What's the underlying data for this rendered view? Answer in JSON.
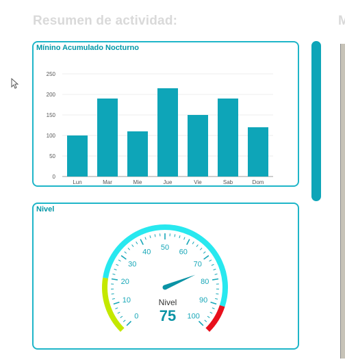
{
  "header": {
    "title": "Resumen de actividad:",
    "right_title_fragment": "M"
  },
  "bar_card": {
    "title": "Mínino Acumulado Nocturno"
  },
  "gauge_card": {
    "title": "Nivel"
  },
  "colors": {
    "accent": "#0ea5b8",
    "bar": "#0ea5b8",
    "title": "#0097a7",
    "gauge_yellow": "#c4e800",
    "gauge_cyan": "#28e8ef",
    "gauge_red": "#e8101c"
  },
  "icons": {
    "cursor": "mouse-pointer-icon"
  },
  "chart_data": [
    {
      "type": "bar",
      "title": "Mínino Acumulado Nocturno",
      "categories": [
        "Lun",
        "Mar",
        "Mie",
        "Jue",
        "Vie",
        "Sab",
        "Dom"
      ],
      "values": [
        100,
        190,
        110,
        215,
        150,
        190,
        120
      ],
      "yticks": [
        "0",
        "50",
        "100",
        "150",
        "200",
        "250"
      ],
      "ylim": [
        0,
        250
      ],
      "grid": true
    },
    {
      "type": "gauge",
      "title": "Nivel",
      "value": 75,
      "value_label": "Nivel",
      "value_text": "75",
      "min": 0,
      "max": 100,
      "tick_labels": [
        "0",
        "10",
        "20",
        "30",
        "40",
        "50",
        "60",
        "70",
        "80",
        "90",
        "100"
      ],
      "bands": [
        {
          "from": 0,
          "to": 20,
          "color": "#c4e800"
        },
        {
          "from": 20,
          "to": 90,
          "color": "#28e8ef"
        },
        {
          "from": 90,
          "to": 100,
          "color": "#e8101c"
        }
      ]
    }
  ]
}
